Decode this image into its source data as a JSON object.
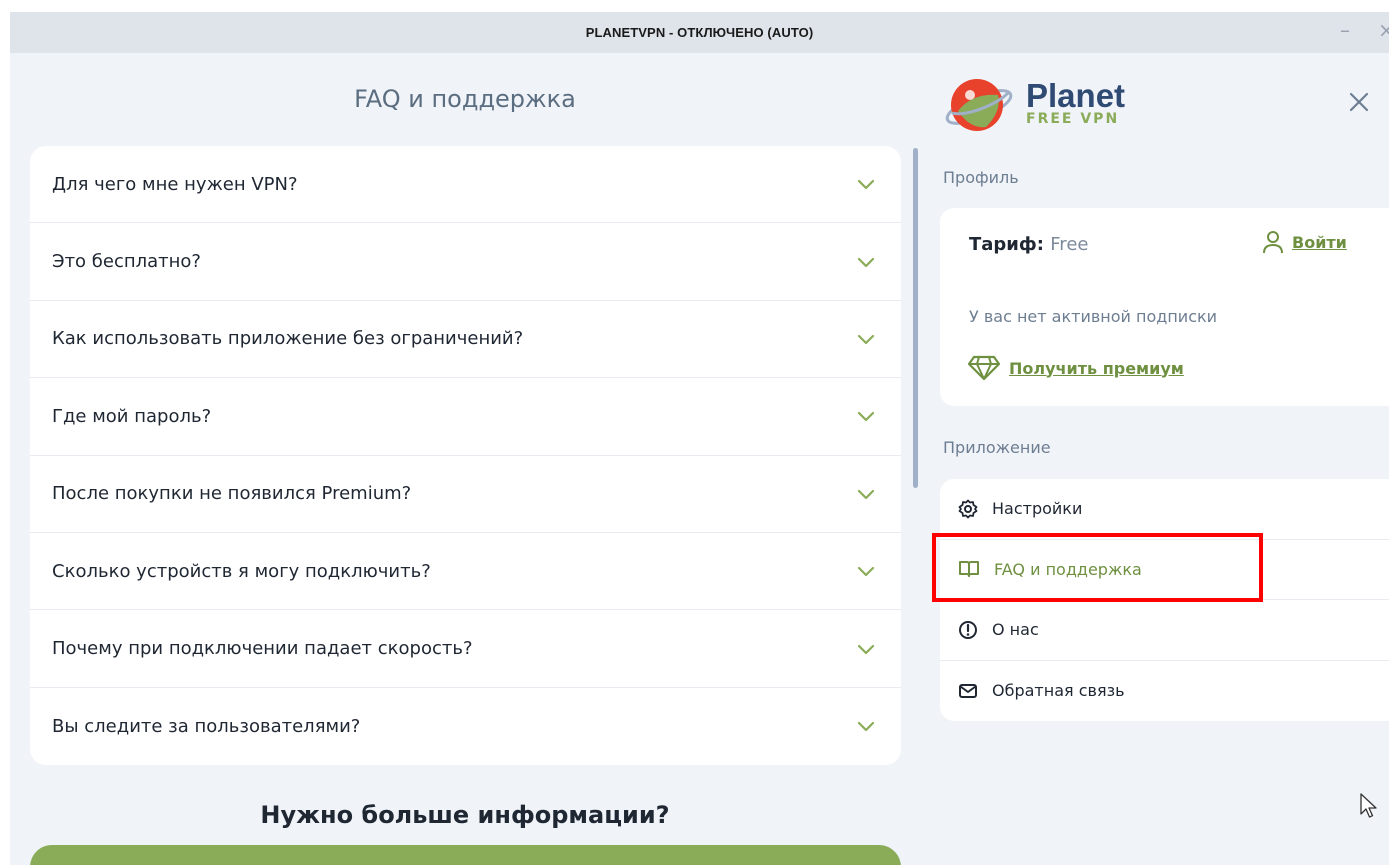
{
  "window": {
    "title": "PLANETVPN - ОТКЛЮЧЕНО (AUTO)",
    "minimize_glyph": "–",
    "close_glyph": "×"
  },
  "faq": {
    "title": "FAQ и поддержка",
    "items": [
      {
        "question": "Для чего мне нужен VPN?"
      },
      {
        "question": "Это бесплатно?"
      },
      {
        "question": "Как использовать приложение без ограничений?"
      },
      {
        "question": "Где мой пароль?"
      },
      {
        "question": "После покупки не появился Premium?"
      },
      {
        "question": "Сколько устройств я могу подключить?"
      },
      {
        "question": "Почему при подключении падает скорость?"
      },
      {
        "question": "Вы следите за пользователями?"
      }
    ],
    "more_info_title": "Нужно больше информации?"
  },
  "sidebar": {
    "logo": {
      "name": "Planet",
      "tagline": "FREE VPN"
    },
    "profile": {
      "section_label": "Профиль",
      "tariff_label": "Тариф:",
      "tariff_value": "Free",
      "login_label": "Войти",
      "no_subscription": "У вас нет активной подписки",
      "premium_label": "Получить премиум"
    },
    "app": {
      "section_label": "Приложение",
      "items": [
        {
          "label": "Настройки",
          "icon": "gear-icon"
        },
        {
          "label": "FAQ и поддержка",
          "icon": "book-icon",
          "active": true
        },
        {
          "label": "О нас",
          "icon": "info-icon"
        },
        {
          "label": "Обратная связь",
          "icon": "envelope-icon"
        }
      ]
    }
  },
  "colors": {
    "accent_green": "#8aab58",
    "brand_blue": "#2f4a73",
    "highlight_red": "#ff0000"
  }
}
